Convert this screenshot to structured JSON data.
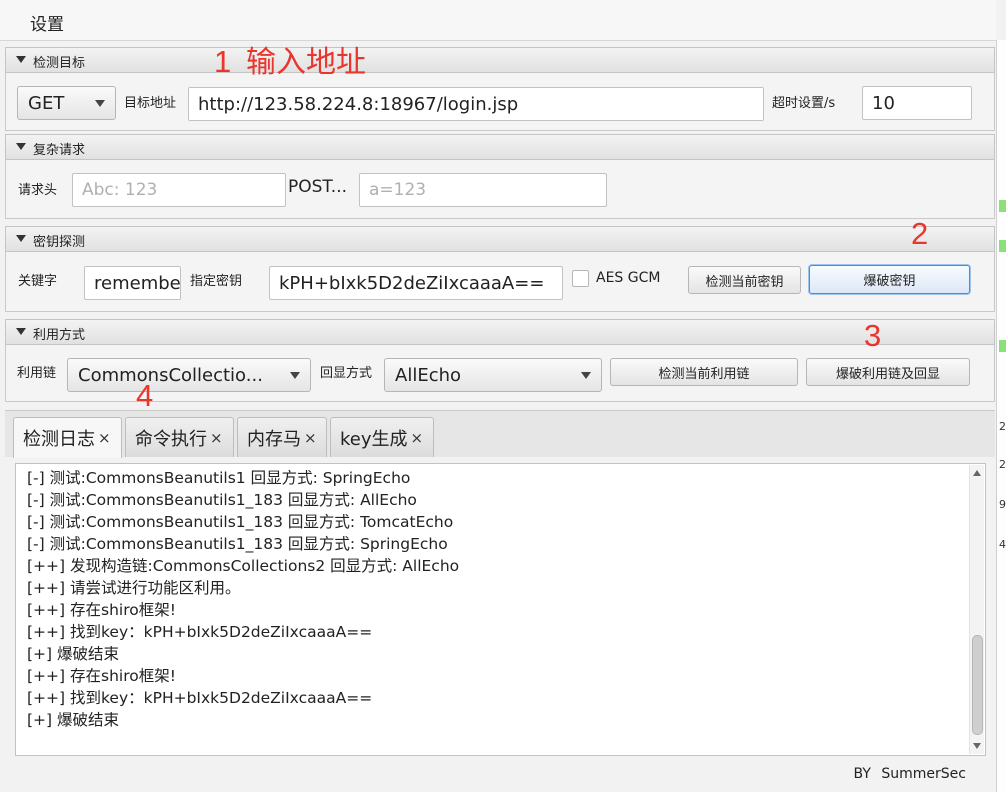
{
  "menubar": {
    "settings_label": "设置"
  },
  "annotations": {
    "a1_number": "1",
    "a1_text": "输入地址",
    "a2": "2",
    "a3": "3",
    "a4": "4"
  },
  "target_section": {
    "title": "检测目标",
    "method_value": "GET",
    "url_label": "目标地址",
    "url_value": "http://123.58.224.8:18967/login.jsp",
    "timeout_label": "超时设置/s",
    "timeout_value": "10"
  },
  "complex_section": {
    "title": "复杂请求",
    "header_label": "请求头",
    "header_placeholder": "Abc: 123",
    "post_label": "POST...",
    "post_placeholder": "a=123"
  },
  "key_section": {
    "title": "密钥探测",
    "keyword_label": "关键字",
    "keyword_value": "rememberMe",
    "key_label": "指定密钥",
    "key_value": "kPH+bIxk5D2deZiIxcaaaA==",
    "aes_gcm_label": "AES GCM",
    "detect_key_button": "检测当前密钥",
    "brute_key_button": "爆破密钥"
  },
  "exploit_section": {
    "title": "利用方式",
    "chain_label": "利用链",
    "chain_value": "CommonsCollectio...",
    "echo_label": "回显方式",
    "echo_value": "AllEcho",
    "detect_chain_button": "检测当前利用链",
    "brute_chain_button": "爆破利用链及回显"
  },
  "tabs": [
    {
      "label": "检测日志",
      "close": "×"
    },
    {
      "label": "命令执行",
      "close": "×"
    },
    {
      "label": "内存马",
      "close": "×"
    },
    {
      "label": "key生成",
      "close": "×"
    }
  ],
  "log_lines": [
    "[-] 测试:CommonsBeanutils1  回显方式: SpringEcho",
    "[-] 测试:CommonsBeanutils1_183  回显方式: AllEcho",
    "[-] 测试:CommonsBeanutils1_183  回显方式: TomcatEcho",
    "[-] 测试:CommonsBeanutils1_183  回显方式: SpringEcho",
    "[++] 发现构造链:CommonsCollections2  回显方式: AllEcho",
    "[++] 请尝试进行功能区利用。",
    "[++] 存在shiro框架!",
    "[++] 找到key：kPH+bIxk5D2deZiIxcaaaA==",
    "[+] 爆破结束",
    "[++] 存在shiro框架!",
    "[++] 找到key：kPH+bIxk5D2deZiIxcaaaA==",
    "[+] 爆破结束"
  ],
  "footer": {
    "credit": "BY  SummerSec"
  },
  "edge_glyphs": [
    "2",
    "2",
    "9",
    "4"
  ],
  "colors": {
    "annotation_red": "#e8362d",
    "focus_blue": "#4a8ed6",
    "edge_green": "#8ce07a"
  }
}
